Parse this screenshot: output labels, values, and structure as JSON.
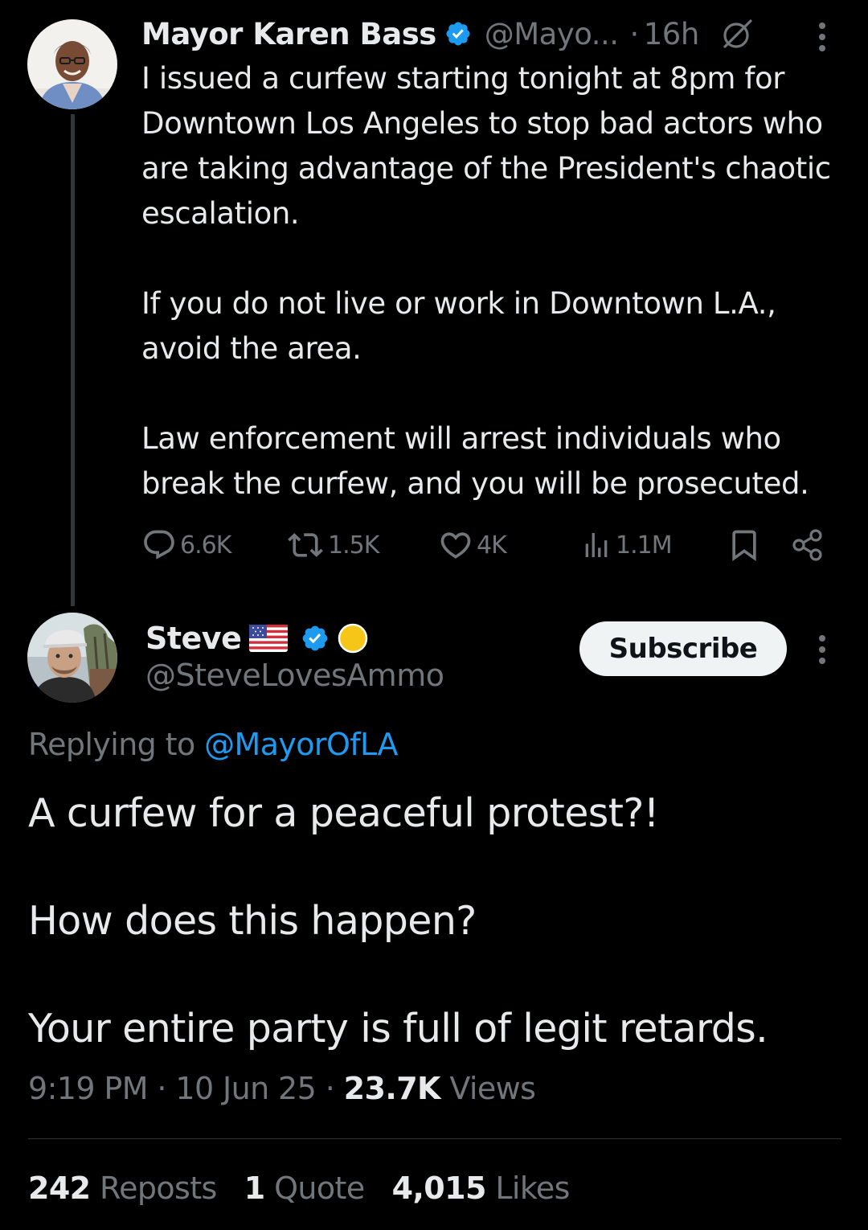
{
  "parent_tweet": {
    "author_name": "Mayor Karen Bass",
    "author_handle": "@Mayo...",
    "separator": "·",
    "time_ago": "16h",
    "text_paragraphs": [
      "I issued a curfew starting tonight at 8pm for Downtown Los Angeles to stop bad actors who are taking advantage of the President's chaotic escalation.",
      "If you do not live or work in Downtown L.A., avoid the area.",
      "Law enforcement will arrest individuals who break the curfew, and you will be prosecuted."
    ],
    "actions": {
      "replies": "6.6K",
      "reposts": "1.5K",
      "likes": "4K",
      "views": "1.1M"
    },
    "icons": [
      "verified-badge-icon",
      "grok-icon",
      "more-icon",
      "reply-icon",
      "repost-icon",
      "like-icon",
      "views-icon",
      "bookmark-icon",
      "share-icon"
    ]
  },
  "reply_tweet": {
    "author_name": "Steve",
    "author_handle": "@SteveLovesAmmo",
    "subscribe_label": "Subscribe",
    "replying_prefix": "Replying to",
    "replying_handle": "@MayorOfLA",
    "text_paragraphs": [
      "A curfew for a peaceful protest?!",
      "How does this happen?",
      "Your entire party is full of legit retards."
    ],
    "time": "9:19 PM",
    "date": "10 Jun 25",
    "separator": "·",
    "views_count": "23.7K",
    "views_label": "Views",
    "stats": {
      "reposts_count": "242",
      "reposts_label": "Reposts",
      "quotes_count": "1",
      "quotes_label": "Quote",
      "likes_count": "4,015",
      "likes_label": "Likes"
    },
    "icons": [
      "us-flag-icon",
      "verified-badge-icon",
      "gold-emoji-icon",
      "more-icon"
    ]
  },
  "colors": {
    "background": "#000000",
    "text_primary": "#e7e9ea",
    "text_muted": "#71767b",
    "accent_blue": "#1d9bf0",
    "button_bg": "#eff3f4"
  }
}
